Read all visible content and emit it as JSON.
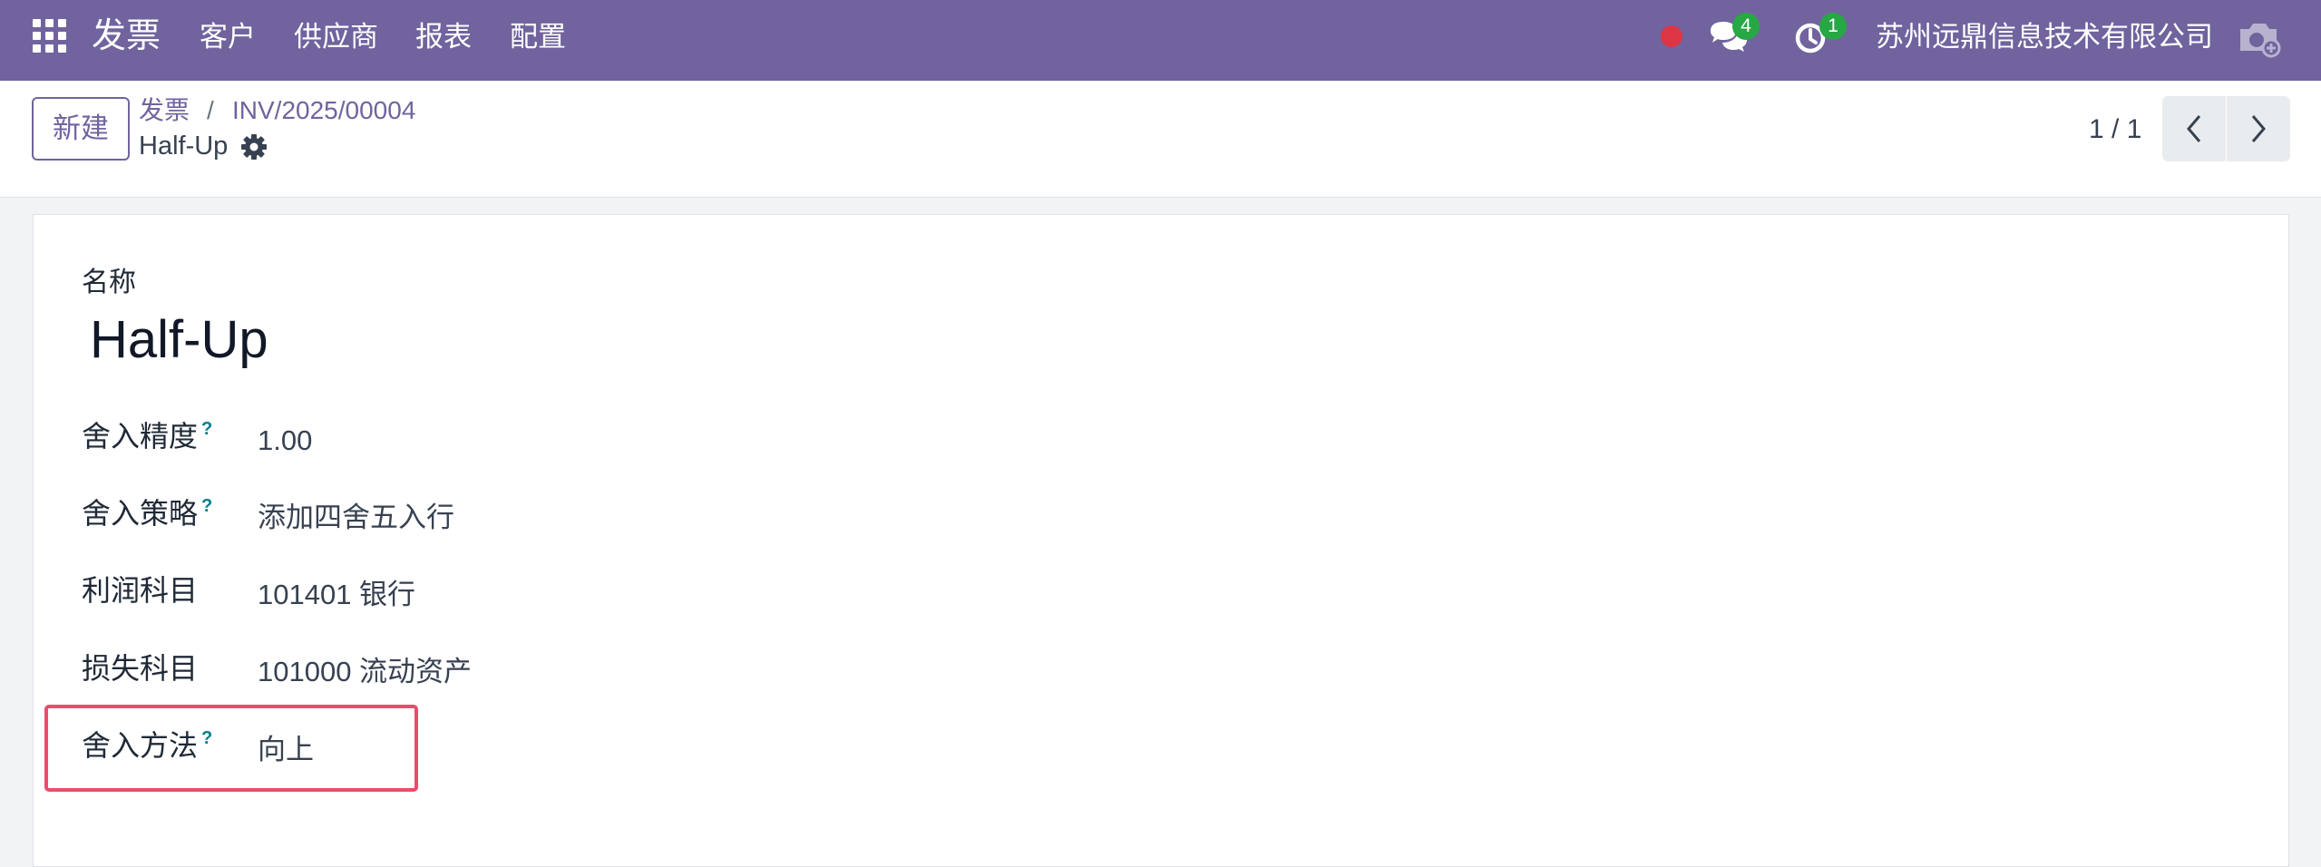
{
  "navbar": {
    "brand": "发票",
    "menu": [
      "客户",
      "供应商",
      "报表",
      "配置"
    ],
    "chat_badge": "4",
    "activity_badge": "1",
    "company": "苏州远鼎信息技术有限公司",
    "colors": {
      "primary": "#71639e",
      "badge": "#28a745",
      "record_dot": "#dc3545"
    }
  },
  "control_panel": {
    "new_label": "新建",
    "breadcrumb_parent": "发票",
    "breadcrumb_separator": "/",
    "breadcrumb_current": "INV/2025/00004",
    "record_name": "Half-Up",
    "pager_value": "1 / 1"
  },
  "form": {
    "name_label": "名称",
    "name_value": "Half-Up",
    "fields": [
      {
        "label": "舍入精度",
        "help": "?",
        "value": "1.00"
      },
      {
        "label": "舍入策略",
        "help": "?",
        "value": "添加四舍五入行"
      },
      {
        "label": "利润科目",
        "value": "101401 银行"
      },
      {
        "label": "损失科目",
        "value": "101000 流动资产"
      },
      {
        "label": "舍入方法",
        "help": "?",
        "value": "向上"
      }
    ],
    "highlight_color": "#ea4d6c"
  },
  "icons": [
    "apps-icon",
    "chat-icon",
    "clock-icon",
    "camera-icon",
    "gear-icon",
    "chevron-left-icon",
    "chevron-right-icon"
  ]
}
